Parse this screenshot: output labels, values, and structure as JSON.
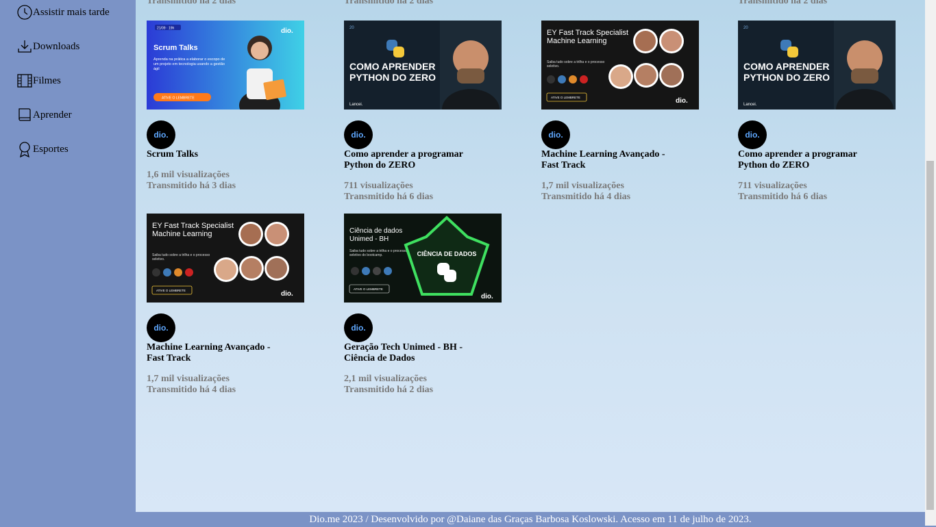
{
  "sidebar": {
    "items": [
      {
        "label": "Assistir mais tarde",
        "icon": "clock-icon"
      },
      {
        "label": "Downloads",
        "icon": "download-icon"
      },
      {
        "label": "Filmes",
        "icon": "film-icon"
      },
      {
        "label": "Aprender",
        "icon": "book-icon"
      },
      {
        "label": "Esportes",
        "icon": "award-icon"
      }
    ]
  },
  "top_partial": [
    "Transmitido há 2 dias",
    "Transmitido há 2 dias",
    "Transmitido há 2 dias"
  ],
  "videos": [
    {
      "title": "Scrum Talks",
      "views": "1,6 mil visualizações",
      "time": "Transmitido há 3 dias",
      "thumb": {
        "heading": "Scrum Talks",
        "tag": "21/09 · 19h",
        "sub": "Aprenda na prática a elaborar o escopo de um projeto em tecnologia usando a gestão ágil",
        "cta": "ATIVE O LEMBRETE",
        "brand": "dio."
      }
    },
    {
      "title": "Como aprender a programar Python do ZERO",
      "views": "711 visualizações",
      "time": "Transmitido há 6 dias",
      "thumb": {
        "heading1": "COMO APRENDER",
        "heading2": "PYTHON DO ZERO",
        "tag": "20",
        "brand": "Lancei."
      }
    },
    {
      "title": "Machine Learning Avançado - Fast Track",
      "views": "1,7 mil visualizações",
      "time": "Transmitido há 4 dias",
      "thumb": {
        "heading": "EY Fast Track Specialist Machine Learning",
        "sub": "Saiba tudo sobre a trilha e o processo seletivo.",
        "cta": "ATIVE O LEMBRETE",
        "brand": "dio."
      }
    },
    {
      "title": "Como aprender a programar Python do ZERO",
      "views": "711 visualizações",
      "time": "Transmitido há 6 dias",
      "thumb": {
        "heading1": "COMO APRENDER",
        "heading2": "PYTHON DO ZERO",
        "tag": "20",
        "brand": "Lancei."
      }
    },
    {
      "title": "Machine Learning Avançado - Fast Track",
      "views": "1,7 mil visualizações",
      "time": "Transmitido há 4 dias",
      "thumb": {
        "heading": "EY Fast Track Specialist Machine Learning",
        "sub": "Saiba tudo sobre a trilha e o processo seletivo.",
        "cta": "ATIVE O LEMBRETE",
        "brand": "dio."
      }
    },
    {
      "title": "Geração Tech Unimed - BH - Ciência de Dados",
      "views": "2,1 mil visualizações",
      "time": "Transmitido há 2 dias",
      "thumb": {
        "heading": "Ciência de dados Unimed - BH",
        "sub": "Saiba tudo sobre a trilha e o processo seletivo do bootcamp.",
        "badge": "CIÊNCIA DE DADOS",
        "cta": "ATIVE O LEMBRETE",
        "brand": "dio."
      }
    }
  ],
  "avatar_brand": "dio.",
  "footer": "Dio.me 2023 / Desenvolvido por @Daiane das Graças Barbosa Koslowski. Acesso em 11 de julho de 2023.",
  "colors": {
    "sidebar": "#7b93c6",
    "main_top": "#b7d6ea",
    "main_bottom": "#d8e7f7",
    "meta_text": "#7a7a7a"
  }
}
